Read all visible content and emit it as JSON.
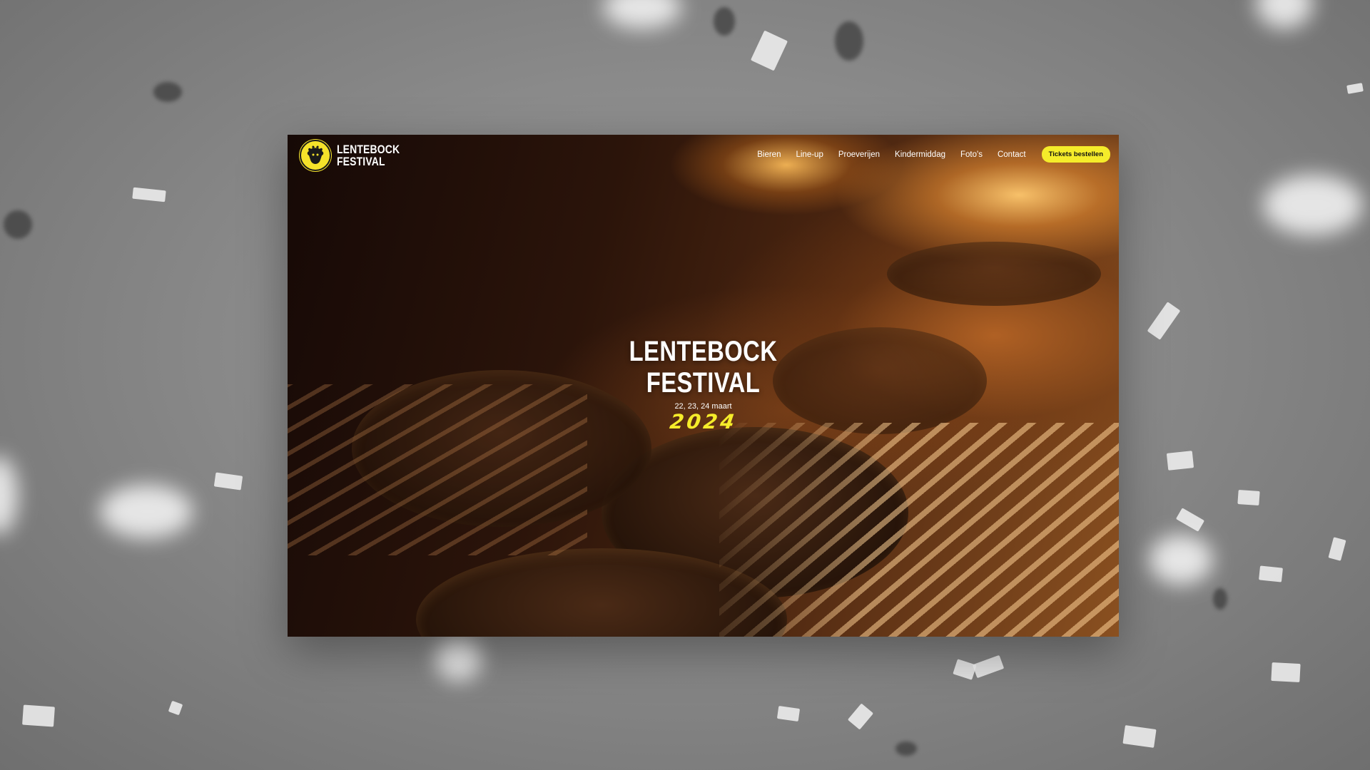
{
  "site": {
    "logo_line1": "LENTEBOCK",
    "logo_line2": "FESTIVAL",
    "logo_icon": "goat-head-icon"
  },
  "nav": {
    "items": [
      {
        "label": "Bieren"
      },
      {
        "label": "Line-up"
      },
      {
        "label": "Proeverijen"
      },
      {
        "label": "Kindermiddag"
      },
      {
        "label": "Foto's"
      },
      {
        "label": "Contact"
      }
    ],
    "cta_label": "Tickets bestellen"
  },
  "hero": {
    "title_line1": "LENTEBOCK",
    "title_line2": "FESTIVAL",
    "dates": "22, 23, 24 maart",
    "year": "2024"
  },
  "colors": {
    "accent": "#f5ec2a",
    "text": "#ffffff",
    "backdrop": "#8a8a8a"
  }
}
